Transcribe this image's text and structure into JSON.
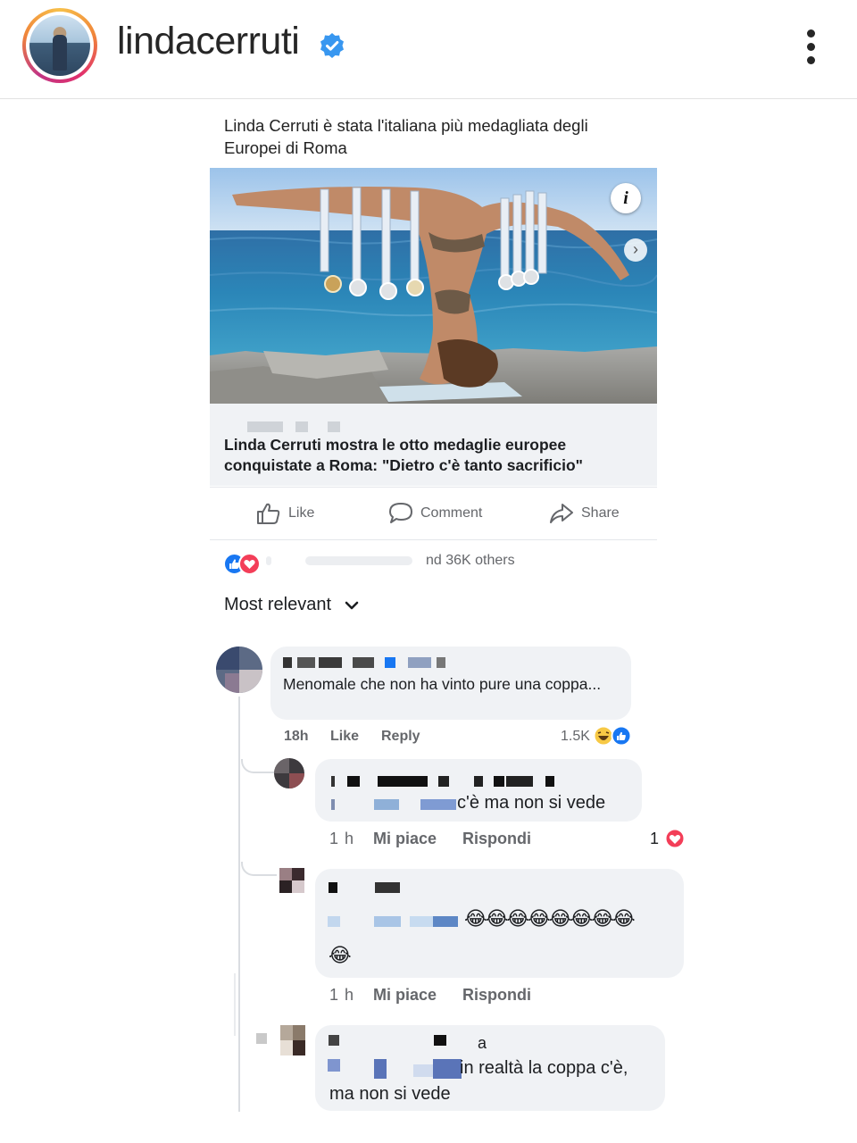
{
  "instagram": {
    "username": "lindacerruti",
    "verified_icon": "verified-badge-icon",
    "more_icon": "more-vertical-icon"
  },
  "post": {
    "text": "Linda Cerruti è stata l'italiana più medagliata degli Europei di Roma",
    "info_icon_label": "i",
    "link_title": "Linda Cerruti mostra le otto medaglie europee conquistate a Roma: \"Dietro c'è tanto sacrificio\"",
    "actions": {
      "like": "Like",
      "comment": "Comment",
      "share": "Share"
    },
    "reactions_text": "nd 36K others",
    "sort_label": "Most relevant"
  },
  "comments": [
    {
      "text": "Menomale che non ha vinto pure una coppa...",
      "time": "18h",
      "like": "Like",
      "reply": "Reply",
      "reaction_count": "1.5K"
    }
  ],
  "replies": [
    {
      "text": "c'è ma non si vede",
      "time": "1 h",
      "like": "Mi piace",
      "reply": "Rispondi",
      "reaction_count": "1"
    },
    {
      "text": "😂😂😂😂😂😂😂😂",
      "text2": "😂",
      "time": "1 h",
      "like": "Mi piace",
      "reply": "Rispondi"
    },
    {
      "name_suffix": "a",
      "text": "in realtà la coppa c'è,",
      "text2": "ma non si vede"
    }
  ],
  "colors": {
    "fb_blue": "#1877f2",
    "love_red": "#f33e58",
    "muted": "#65676b",
    "bubble": "#f0f2f5"
  }
}
